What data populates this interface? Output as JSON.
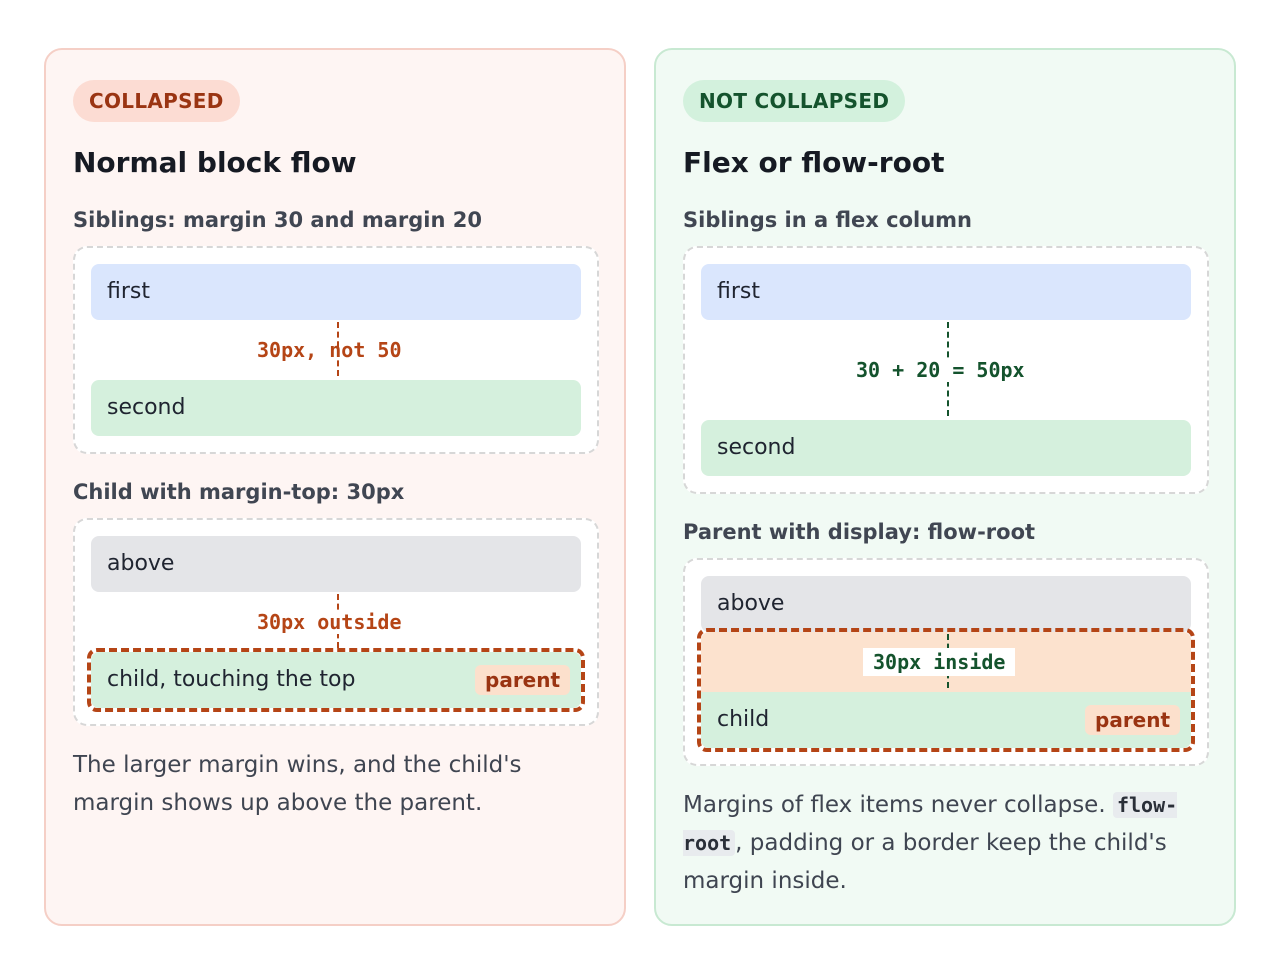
{
  "left": {
    "badge": "COLLAPSED",
    "title": "Normal block flow",
    "siblings": {
      "heading": "Siblings: margin 30 and margin 20",
      "first": "first",
      "second": "second",
      "gap_label": "30px, not 50"
    },
    "child": {
      "heading": "Child with margin-top: 30px",
      "above": "above",
      "gap_label": "30px outside",
      "child_label": "child, touching the top",
      "parent_tag": "parent"
    },
    "caption": "The larger margin wins, and the child's margin shows up above the parent."
  },
  "right": {
    "badge": "NOT COLLAPSED",
    "title": "Flex or flow-root",
    "siblings": {
      "heading": "Siblings in a flex column",
      "first": "first",
      "second": "second",
      "gap_label": "30 + 20 = 50px"
    },
    "child": {
      "heading": "Parent with display: flow-root",
      "above": "above",
      "gap_label": "30px inside",
      "child_label": "child",
      "parent_tag": "parent"
    },
    "caption": {
      "before": "Margins of flex items never collapse. ",
      "code": "flow-root",
      "after": ", padding or a border keep the child's margin inside."
    }
  },
  "colors": {
    "collapsed_accent": "#b54516",
    "not_collapsed_accent": "#14532d",
    "first_box": "#dae6fd",
    "second_box": "#d5f0dd",
    "above_box": "#e4e5e8"
  }
}
